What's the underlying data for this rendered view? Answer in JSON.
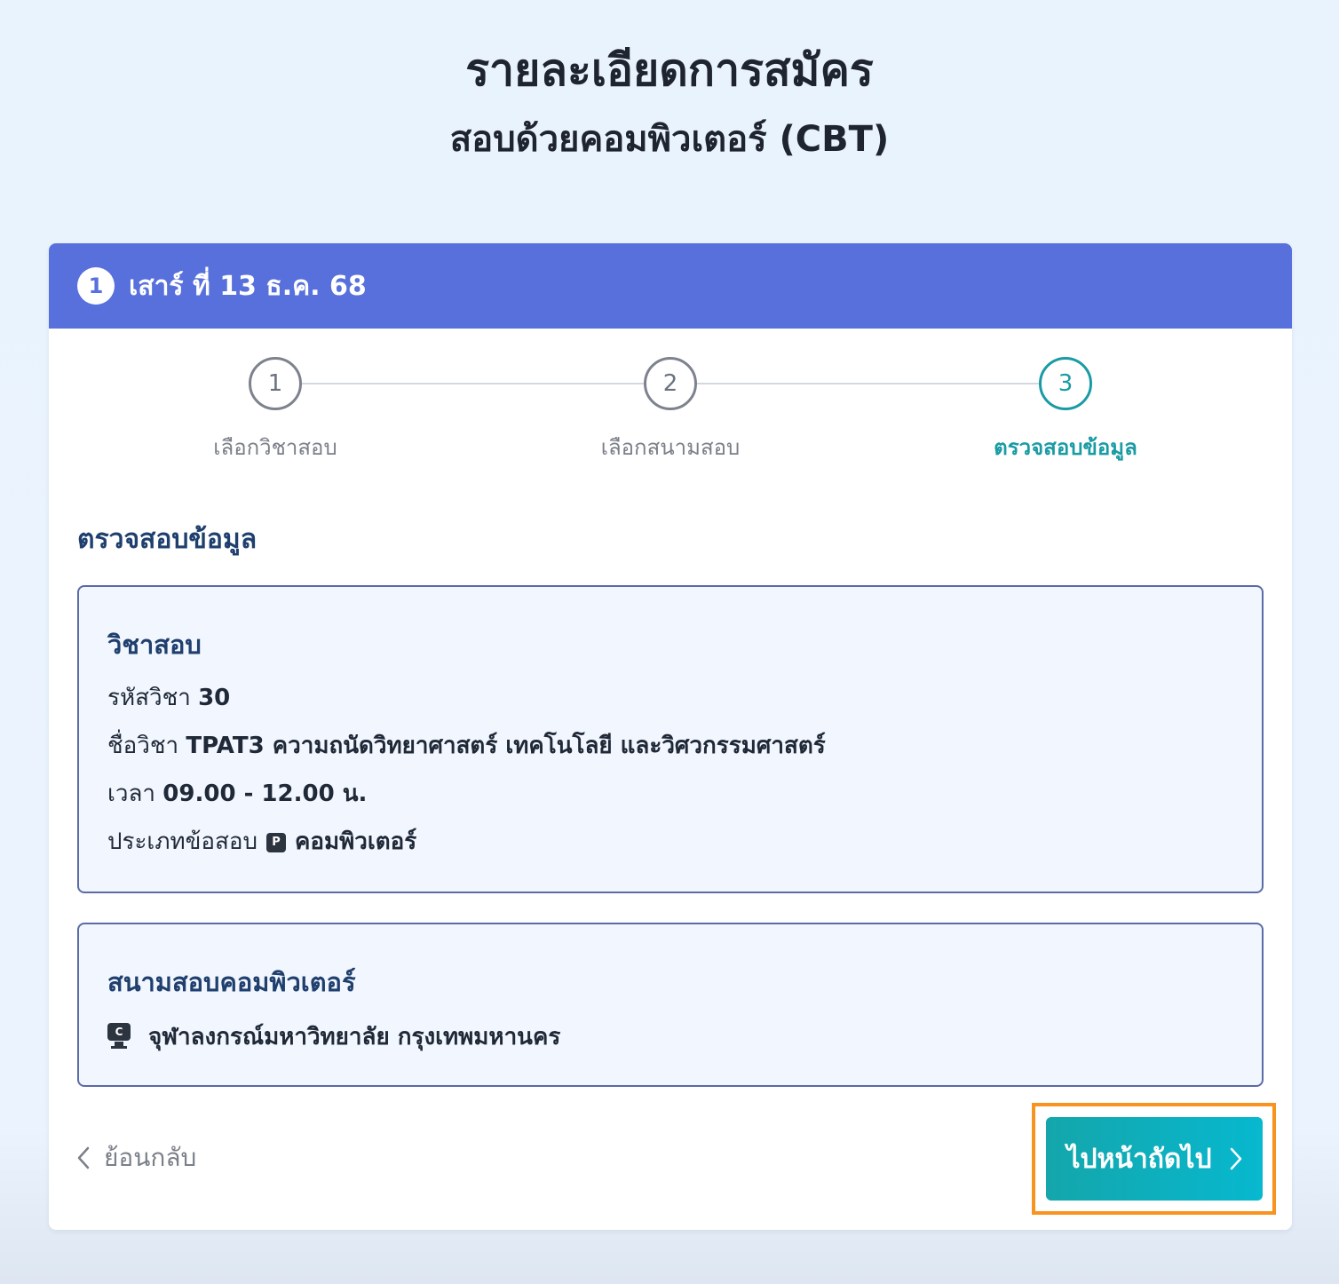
{
  "page": {
    "title": "รายละเอียดการสมัคร",
    "subtitle": "สอบด้วยคอมพิวเตอร์ (CBT)"
  },
  "card": {
    "header": {
      "badge": "1",
      "title": "เสาร์ ที่ 13 ธ.ค. 68"
    }
  },
  "stepper": {
    "steps": [
      {
        "number": "1",
        "label": "เลือกวิชาสอบ",
        "state": "done"
      },
      {
        "number": "2",
        "label": "เลือกสนามสอบ",
        "state": "done"
      },
      {
        "number": "3",
        "label": "ตรวจสอบข้อมูล",
        "state": "active"
      }
    ]
  },
  "review": {
    "title": "ตรวจสอบข้อมูล",
    "subject": {
      "heading": "วิชาสอบ",
      "code_label": "รหัสวิชา",
      "code_value": "30",
      "name_label": "ชื่อวิชา",
      "name_value": "TPAT3 ความถนัดวิทยาศาสตร์ เทคโนโลยี และวิศวกรรมศาสตร์",
      "time_label": "เวลา",
      "time_value": "09.00 - 12.00 น.",
      "type_label": "ประเภทข้อสอบ",
      "type_icon_letter": "P",
      "type_value": "คอมพิวเตอร์"
    },
    "venue": {
      "heading": "สนามสอบคอมพิวเตอร์",
      "icon_letter": "C",
      "name": "จุฬาลงกรณ์มหาวิทยาลัย กรุงเทพมหานคร"
    }
  },
  "actions": {
    "back_label": "ย้อนกลับ",
    "next_label": "ไปหน้าถัดไป"
  },
  "colors": {
    "header_bg": "#5770dc",
    "accent_teal": "#1a9ba4",
    "button_gradient_start": "#14a6ab",
    "button_gradient_end": "#07b8cf",
    "highlight_outline": "#f7931e",
    "heading_navy": "#1f3f6e",
    "box_border": "#5a6ba7"
  }
}
